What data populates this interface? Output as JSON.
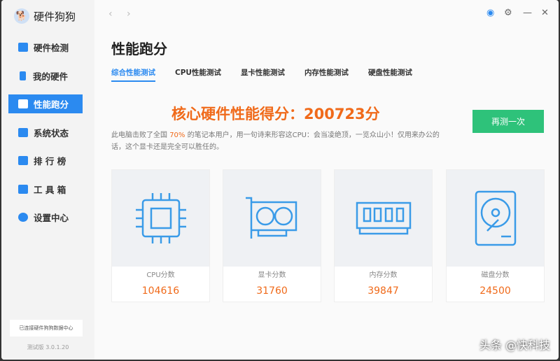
{
  "app": {
    "title": "硬件狗狗"
  },
  "sidebar": {
    "items": [
      {
        "label": "硬件检测"
      },
      {
        "label": "我的硬件"
      },
      {
        "label": "性能跑分"
      },
      {
        "label": "系统状态"
      },
      {
        "label": "排 行 榜"
      },
      {
        "label": "工 具 箱"
      },
      {
        "label": "设置中心"
      }
    ],
    "connection": "已连接硬件狗狗数据中心",
    "version": "测试版 3.0.1.20"
  },
  "main": {
    "title": "性能跑分",
    "tabs": [
      {
        "label": "综合性能测试"
      },
      {
        "label": "CPU性能测试"
      },
      {
        "label": "显卡性能测试"
      },
      {
        "label": "内存性能测试"
      },
      {
        "label": "硬盘性能测试"
      }
    ],
    "score_text": "核心硬件性能得分：200723分",
    "desc_pre": "此电脑击败了全国 ",
    "desc_pct": "70%",
    "desc_post": " 的笔记本用户，用一句诗来形容这CPU：会当凌绝顶，一览众山小！仅用来办公的话，这个显卡还是完全可以胜任的。",
    "retest": "再测一次",
    "cards": [
      {
        "label": "CPU分数",
        "value": "104616"
      },
      {
        "label": "显卡分数",
        "value": "31760"
      },
      {
        "label": "内存分数",
        "value": "39847"
      },
      {
        "label": "磁盘分数",
        "value": "24500"
      }
    ]
  },
  "watermark": "头条 @快科技"
}
